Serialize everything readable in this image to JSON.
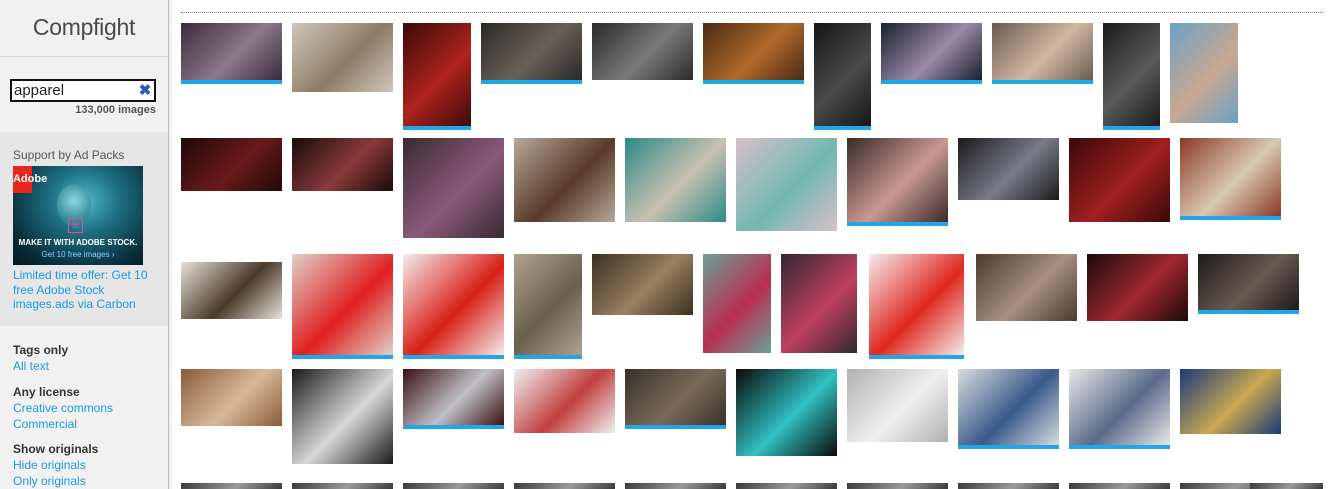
{
  "logo": "Compfight",
  "search": {
    "value": "apparel",
    "count": "133,000 images"
  },
  "ad": {
    "label": "Support by Ad Packs",
    "logo_text": "Adobe",
    "badge": "St",
    "headline": "MAKE IT WITH ADOBE STOCK.",
    "subline": "Get 10 free images ›",
    "text": "Limited time offer: Get 10 free Adobe Stock images.ads via Carbon"
  },
  "filters": [
    {
      "title": "Tags only",
      "links": [
        "All text"
      ]
    },
    {
      "title": "Any license",
      "links": [
        "Creative commons",
        "Commercial"
      ]
    },
    {
      "title": "Show originals",
      "links": [
        "Hide originals",
        "Only originals"
      ]
    }
  ],
  "colors": {
    "accent": "#21a6e8",
    "link": "#1a9be0",
    "sidebar": "#f1f1f1"
  },
  "thumbnails": [
    {
      "name": "thumb-veiled-woman-moon",
      "selected": true
    },
    {
      "name": "thumb-woman-beige-dress-ruins",
      "selected": false
    },
    {
      "name": "thumb-red-hood-woman",
      "selected": true
    },
    {
      "name": "thumb-dark-portrait",
      "selected": true
    },
    {
      "name": "thumb-woman-gray-dark",
      "selected": false
    },
    {
      "name": "thumb-woman-reclining-amber",
      "selected": true
    },
    {
      "name": "thumb-woman-standing-dark",
      "selected": true
    },
    {
      "name": "thumb-woman-night-scene",
      "selected": true
    },
    {
      "name": "thumb-woman-reclining-nude",
      "selected": true
    },
    {
      "name": "thumb-woman-black-outfit",
      "selected": true
    },
    {
      "name": "thumb-woman-bikini-beach",
      "selected": false
    },
    {
      "name": "thumb-dark-red-women",
      "selected": false
    },
    {
      "name": "thumb-two-women-lingerie",
      "selected": false
    },
    {
      "name": "thumb-purple-dress",
      "selected": false
    },
    {
      "name": "thumb-woman-floral-chair",
      "selected": false
    },
    {
      "name": "thumb-woman-vintage-car",
      "selected": false
    },
    {
      "name": "thumb-mermaid-suitcase",
      "selected": false
    },
    {
      "name": "thumb-woman-shorts-collage",
      "selected": true
    },
    {
      "name": "thumb-woman-doorway",
      "selected": false
    },
    {
      "name": "thumb-woman-red-wall",
      "selected": false
    },
    {
      "name": "thumb-fabric-closeup",
      "selected": true
    },
    {
      "name": "thumb-horse-riders-beach",
      "selected": false
    },
    {
      "name": "thumb-red-jumpsuit-marcelo",
      "selected": true
    },
    {
      "name": "thumb-red-ruffle-gown",
      "selected": true
    },
    {
      "name": "thumb-woman-braided-hair",
      "selected": true
    },
    {
      "name": "thumb-woman-plaid-shirt",
      "selected": false
    },
    {
      "name": "thumb-street-market",
      "selected": false
    },
    {
      "name": "thumb-woman-checkered-top",
      "selected": false
    },
    {
      "name": "thumb-red-ruffle-marcelo",
      "selected": true
    },
    {
      "name": "thumb-woman-bodysuit-interior",
      "selected": false
    },
    {
      "name": "thumb-woman-red-corset",
      "selected": false
    },
    {
      "name": "thumb-woman-dark-room",
      "selected": true
    },
    {
      "name": "thumb-man-wagon-autumn",
      "selected": false
    },
    {
      "name": "thumb-woman-hat-denim",
      "selected": false
    },
    {
      "name": "thumb-masked-red-hood",
      "selected": true
    },
    {
      "name": "thumb-dress-pattern-sheet",
      "selected": false
    },
    {
      "name": "thumb-woman-leaning-rail",
      "selected": true
    },
    {
      "name": "thumb-woman-neon-swing",
      "selected": false
    },
    {
      "name": "thumb-white-gown-bubbles",
      "selected": false
    },
    {
      "name": "thumb-store-aisle",
      "selected": true
    },
    {
      "name": "thumb-supermarket-aisle",
      "selected": true
    },
    {
      "name": "thumb-embroidered-labels",
      "selected": false
    },
    {
      "name": "thumb-row5-1",
      "selected": false
    },
    {
      "name": "thumb-row5-2",
      "selected": false
    },
    {
      "name": "thumb-row5-3",
      "selected": false
    },
    {
      "name": "thumb-row5-4",
      "selected": false
    },
    {
      "name": "thumb-row5-5",
      "selected": false
    },
    {
      "name": "thumb-row5-6",
      "selected": false
    },
    {
      "name": "thumb-row5-7",
      "selected": false
    },
    {
      "name": "thumb-row5-8",
      "selected": false
    },
    {
      "name": "thumb-row5-9",
      "selected": false
    },
    {
      "name": "thumb-row5-10",
      "selected": false
    },
    {
      "name": "thumb-row5-11",
      "selected": false
    }
  ]
}
